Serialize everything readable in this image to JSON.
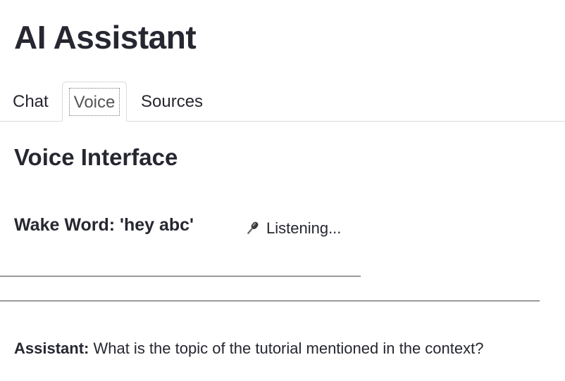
{
  "app": {
    "title": "AI Assistant"
  },
  "tabs": [
    {
      "label": "Chat"
    },
    {
      "label": "Voice",
      "selected": true
    },
    {
      "label": "Sources"
    }
  ],
  "voice": {
    "section_title": "Voice Interface",
    "wake_word_label": "Wake Word: 'hey abc'",
    "status_icon": "microphone-icon",
    "status_text": "Listening..."
  },
  "conversation": {
    "messages": [
      {
        "speaker": "Assistant:",
        "text": " What is the topic of the tutorial mentioned in the context?"
      }
    ]
  }
}
